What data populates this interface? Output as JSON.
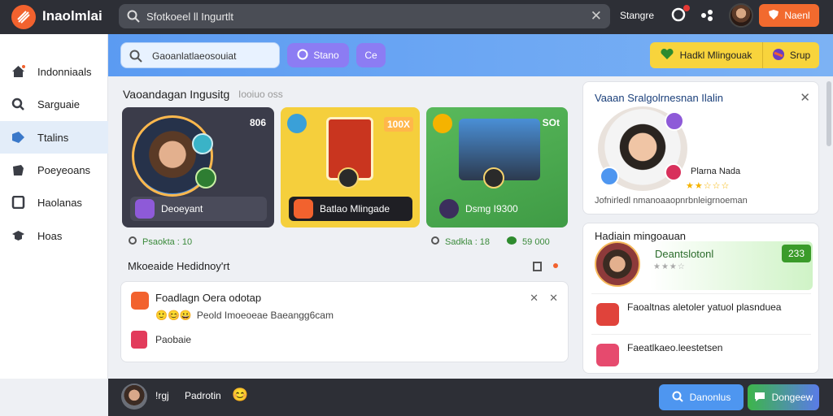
{
  "app": {
    "name": "Inaolmlai"
  },
  "search": {
    "value": "Sfotkoeel ll Ingurtlt"
  },
  "topbar": {
    "link": "Stangre",
    "cta": "Naenl"
  },
  "sidebar": {
    "items": [
      {
        "label": "Indonniaals",
        "icon": "home-icon"
      },
      {
        "label": "Sarguaie",
        "icon": "search-icon"
      },
      {
        "label": "Ttalins",
        "icon": "tag-icon"
      },
      {
        "label": "Poeyeoans",
        "icon": "clipboard-icon"
      },
      {
        "label": "Haolanas",
        "icon": "square-icon"
      },
      {
        "label": "Hoas",
        "icon": "graduation-icon"
      }
    ]
  },
  "subbar": {
    "search_text": "Gaoanlatlaeosouiat",
    "pill1": "Stano",
    "pill2": "Ce",
    "cta": "Hadkl Mlingouak",
    "cta2": "Srup"
  },
  "main": {
    "section_title": "Vaoandagan Ingusitg",
    "section_sub": "Iooiuo oss",
    "cards": [
      {
        "stat": "806",
        "label": "Deoeyant"
      },
      {
        "stat": "100X",
        "label": "Batlao Mlingade"
      },
      {
        "stat": "SOt",
        "label": "Dsmg I9300"
      }
    ],
    "meta_left": "Psaokta : 10",
    "meta_right1": "Sadkla : 18",
    "meta_right2": "59 000",
    "section2_title": "Mkoeaide Hedidnoy'rt",
    "notification": {
      "title": "Foadlagn Oera odotap",
      "sub": "Peold Imoeoeae Baeangg6cam",
      "footer": "Paobaie"
    }
  },
  "right": {
    "panel1": {
      "title": "Vaaan Sralgolrnesnan Ilalin",
      "name": "Plarna Nada",
      "stars": "★★☆☆☆",
      "footer": "Jofnirledl nmanoaaopnrbnleigrnoeman"
    },
    "panel2": {
      "title": "Hadiain mingoauan",
      "name": "Deantslotonl",
      "stars": "★★★☆",
      "score": "233",
      "items": [
        {
          "text": "Faoaltnas aletoler yatuol plasnduea",
          "icon": "shield-icon",
          "color": "#e0433b"
        },
        {
          "text": "Faeatlkaeo.leestetsen",
          "icon": "gift-icon",
          "color": "#e64a6e"
        }
      ]
    }
  },
  "bottombar": {
    "tag": "!rgj",
    "name": "Padrotin",
    "emoji": "😊",
    "btn1": "Danonlus",
    "btn2": "Dongeew"
  },
  "colors": {
    "brand": "#f2622e",
    "accent_blue": "#5b9bf2",
    "cta_yellow": "#f8d43c",
    "dark": "#2d2f36"
  }
}
